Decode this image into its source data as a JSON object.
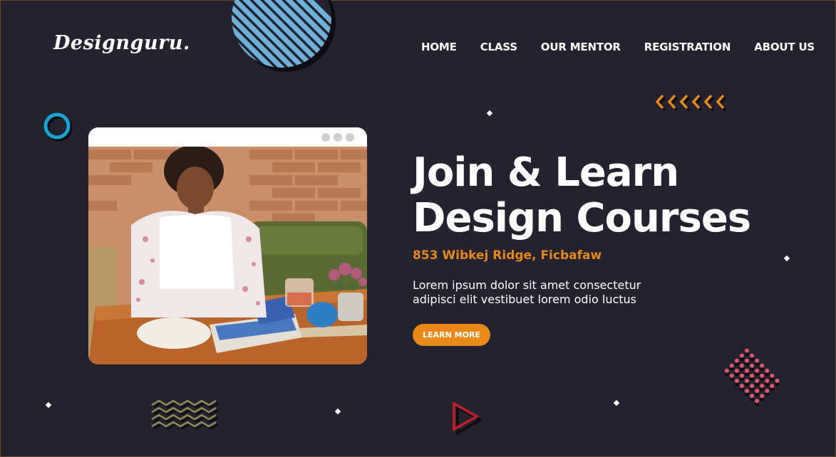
{
  "brand": {
    "logo_text": "Designguru."
  },
  "nav": {
    "items": [
      {
        "label": "HOME"
      },
      {
        "label": "CLASS"
      },
      {
        "label": "OUR MENTOR"
      },
      {
        "label": "REGISTRATION"
      },
      {
        "label": "ABOUT US"
      }
    ]
  },
  "hero": {
    "headline_line1": "Join & Learn",
    "headline_line2": "Design Courses",
    "address": "853 Wibkej Ridge, Ficbafaw",
    "description_line1": "Lorem ipsum dolor sit amet consectetur",
    "description_line2": "adipisci elit vestibuet lorem odio luctus",
    "cta_label": "LEARN MORE"
  },
  "colors": {
    "background": "#25222f",
    "accent_orange": "#e8891a",
    "accent_blue": "#6fb0d8",
    "ring_blue": "#1aa3d0",
    "dot_pink": "#e0566b",
    "zigzag_olive": "#8c8a55",
    "triangle_red": "#c0202a"
  },
  "icons": {
    "striped_circle": "striped-circle-icon",
    "ring": "ring-icon",
    "chevrons": "chevrons-left-icon",
    "dot_grid": "dot-grid-icon",
    "zigzag": "zigzag-icon",
    "play_triangle": "play-triangle-icon"
  }
}
